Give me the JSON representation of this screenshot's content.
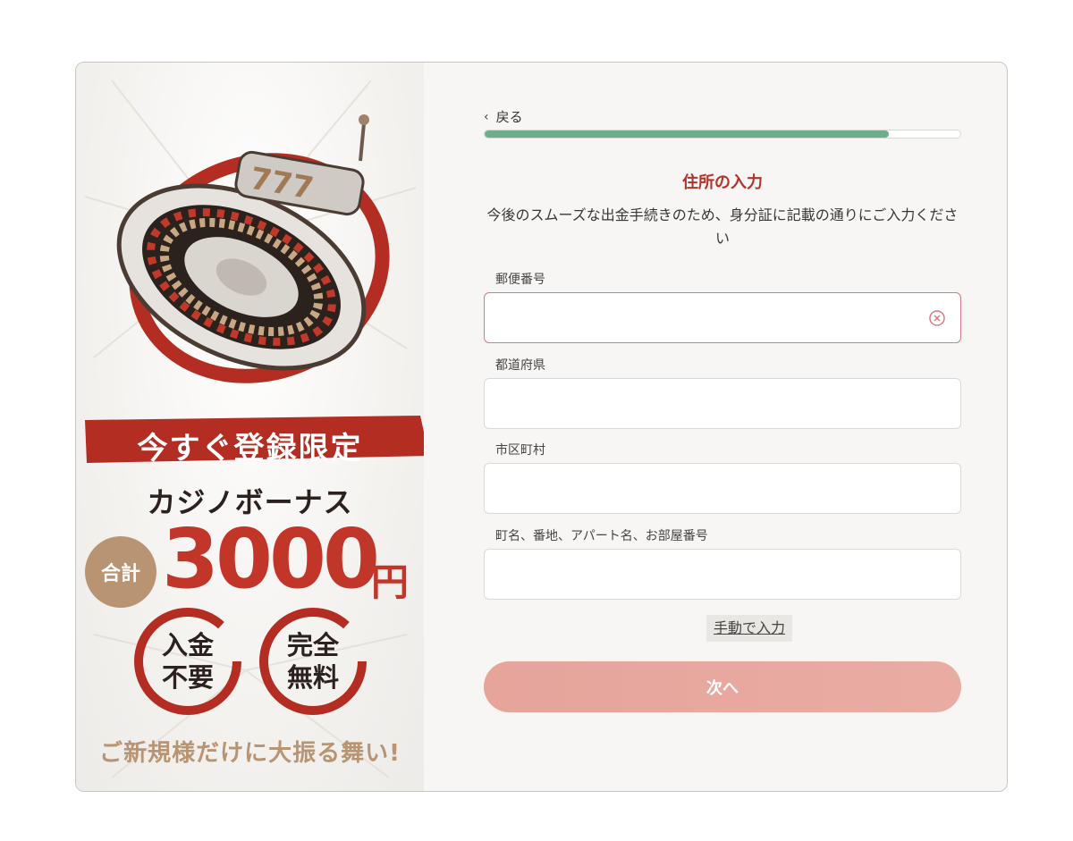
{
  "promo": {
    "banner": "今すぐ登録限定",
    "bonus_title": "カジノボーナス",
    "total_badge": "合計",
    "amount": "3000",
    "amount_unit": "円",
    "circle1": [
      "入金",
      "不要"
    ],
    "circle2": [
      "完全",
      "無料"
    ],
    "tagline": "ご新規様だけに大振る舞い!",
    "colors": {
      "red": "#c2362a",
      "gold": "#b99473"
    }
  },
  "form": {
    "back_label": "戻る",
    "progress_fraction": 0.85,
    "title": "住所の入力",
    "description": "今後のスムーズな出金手続きのため、身分証に記載の通りにご入力ください",
    "fields": [
      {
        "label": "郵便番号",
        "value": "",
        "placeholder": ""
      },
      {
        "label": "都道府県",
        "value": "",
        "placeholder": ""
      },
      {
        "label": "市区町村",
        "value": "",
        "placeholder": ""
      },
      {
        "label": "町名、番地、アパート名、お部屋番号",
        "value": "",
        "placeholder": ""
      }
    ],
    "manual_label": "手動で入力",
    "next_label": "次へ",
    "colors": {
      "title": "#b4322a",
      "progress": "#6fae8b",
      "button": "#e6a49b"
    }
  }
}
